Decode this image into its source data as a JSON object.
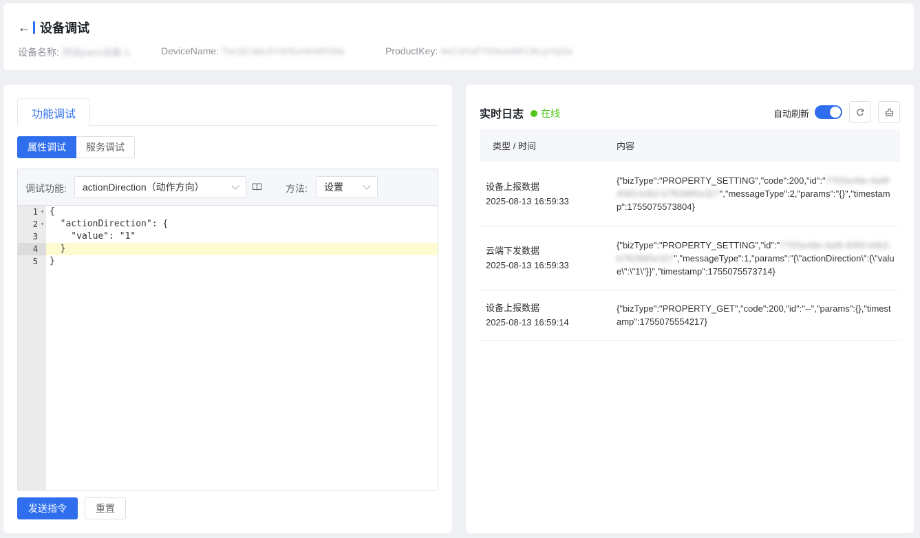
{
  "header": {
    "title": "设备调试",
    "meta": [
      {
        "label": "设备名称:",
        "value": "测试paris设备-1"
      },
      {
        "label": "DeviceName:",
        "value": "7ec2jCabc3Y4r5tuHmWhWa"
      },
      {
        "label": "ProductKey:",
        "value": "4eCdXaPYbNuwMOJkLpYqGa"
      }
    ]
  },
  "left": {
    "tab_label": "功能调试",
    "segments": [
      "属性调试",
      "服务调试"
    ],
    "toolbar": {
      "function_label": "调试功能:",
      "function_value": "actionDirection（动作方向）",
      "method_label": "方法:",
      "method_value": "设置"
    },
    "editor": {
      "line_numbers": [
        "1",
        "2",
        "3",
        "4",
        "5"
      ],
      "lines": [
        "{",
        "  \"actionDirection\": {",
        "    \"value\": \"1\"",
        "  }",
        "}"
      ]
    },
    "send_label": "发送指令",
    "reset_label": "重置"
  },
  "right": {
    "title": "实时日志",
    "status": "在线",
    "auto_refresh_label": "自动刷新",
    "auto_refresh": true,
    "columns": [
      "类型 / 时间",
      "内容"
    ],
    "rows": [
      {
        "type": "设备上报数据",
        "time": "2025-08-13 16:59:33",
        "c1": "{\"bizType\":\"PROPERTY_SETTING\",\"code\":200,\"id\":\"",
        "c_blur": "77f20e49e-9a9f-4083-b0b2-b7f63885e327",
        "c2": "\",\"messageType\":2,\"params\":\"{}\",\"timestamp\":1755075573804}"
      },
      {
        "type": "云端下发数据",
        "time": "2025-08-13 16:59:33",
        "c1": "{\"bizType\":\"PROPERTY_SETTING\",\"id\":\"",
        "c_blur": "77f20e49e-9a9f-4083-b0b2-b7f63885e327",
        "c2": "\",\"messageType\":1,\"params\":\"{\\\"actionDirection\\\":{\\\"value\\\":\\\"1\\\"}}\",\"timestamp\":1755075573714}"
      },
      {
        "type": "设备上报数据",
        "time": "2025-08-13 16:59:14",
        "c1": "{\"bizType\":\"PROPERTY_GET\",\"code\":200,\"id\":\"--\",\"params\":{},\"timestamp\":1755075554217}",
        "c_blur": "",
        "c2": ""
      }
    ]
  },
  "colors": {
    "primary": "#2f6fed",
    "online": "#52c41a",
    "active_line": "#fffbd1"
  }
}
